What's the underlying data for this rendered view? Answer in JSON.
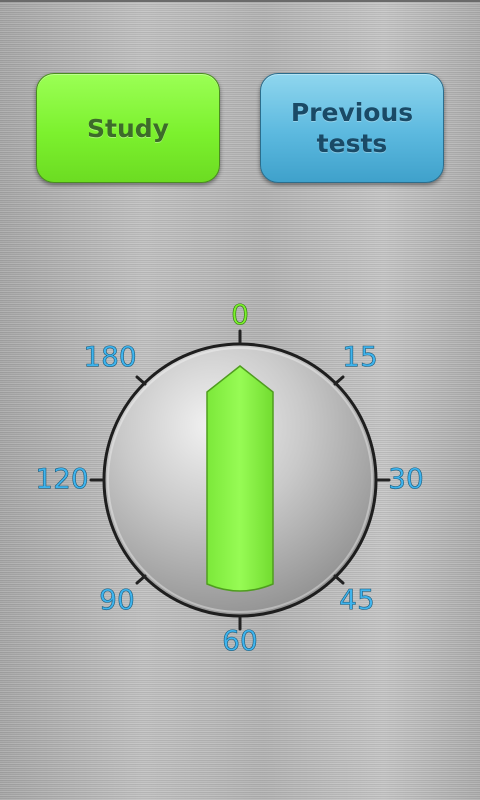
{
  "buttons": {
    "study_label": "Study",
    "previous_tests_label": "Previous\ntests"
  },
  "timer": {
    "scale_labels": [
      "0",
      "15",
      "30",
      "45",
      "60",
      "90",
      "120",
      "180"
    ],
    "label_color": "#3fb4ee",
    "zero_color": "#7cf12e",
    "pointer_color": "#8ef84c",
    "pointer_value": 0
  }
}
